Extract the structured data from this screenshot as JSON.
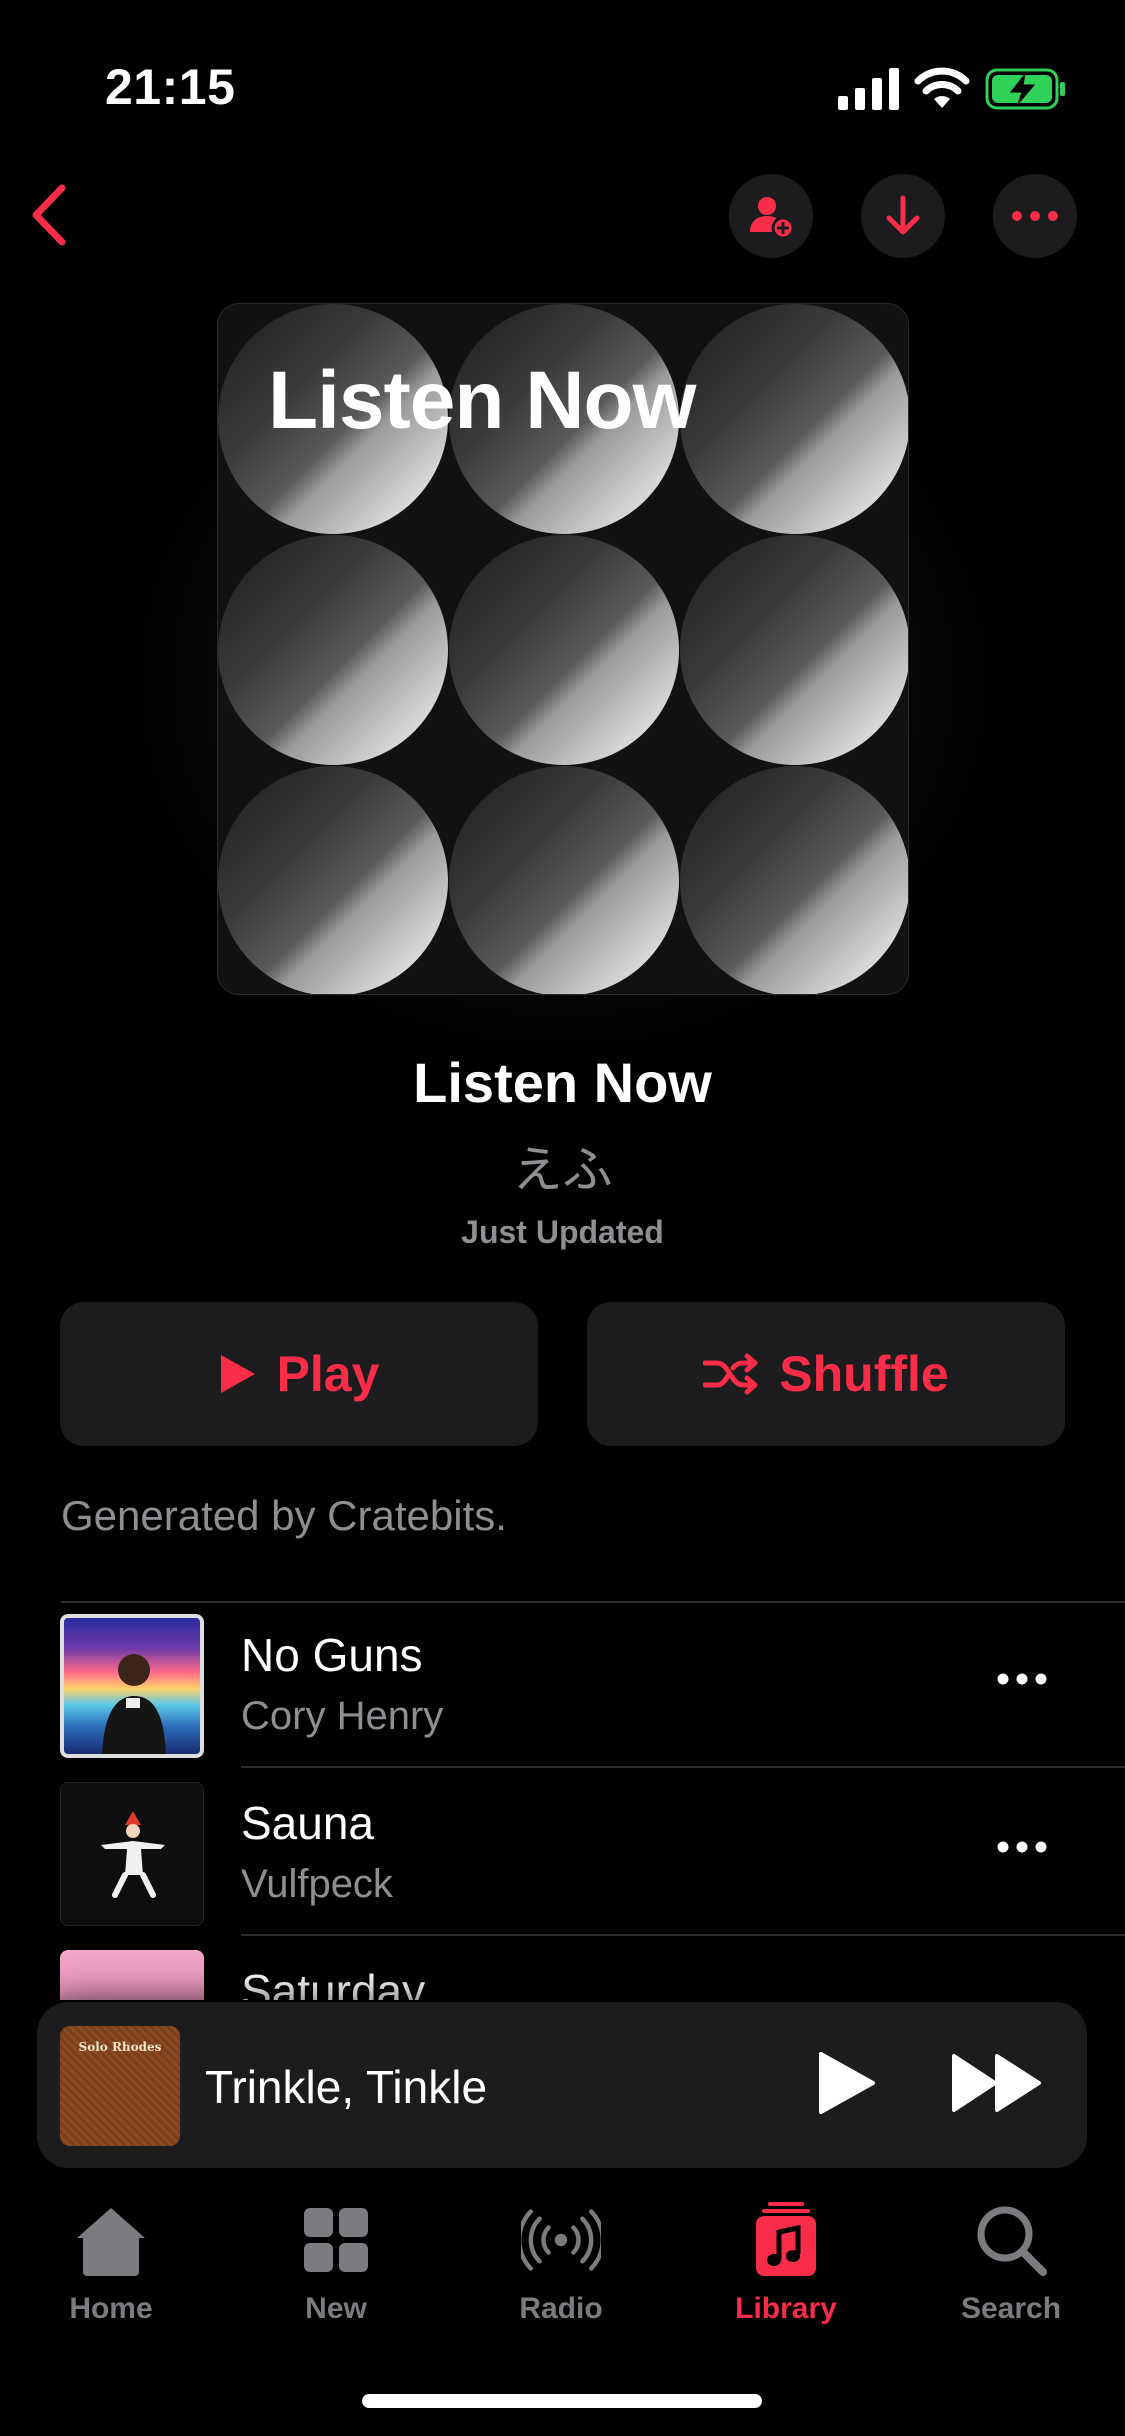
{
  "status_bar": {
    "time": "21:15"
  },
  "playlist": {
    "artwork_title": "Listen Now",
    "title": "Listen Now",
    "owner": "えふ",
    "updated": "Just Updated",
    "description": "Generated by Cratebits."
  },
  "actions": {
    "play_label": "Play",
    "shuffle_label": "Shuffle"
  },
  "tracks": [
    {
      "title": "No Guns",
      "artist": "Cory Henry"
    },
    {
      "title": "Sauna",
      "artist": "Vulfpeck"
    },
    {
      "title": "Saturday",
      "artist": ""
    }
  ],
  "mini_player": {
    "title": "Trinkle, Tinkle",
    "artwork_text": "Solo Rhodes"
  },
  "tab_bar": [
    {
      "label": "Home",
      "icon": "home-icon"
    },
    {
      "label": "New",
      "icon": "grid-icon"
    },
    {
      "label": "Radio",
      "icon": "radio-icon"
    },
    {
      "label": "Library",
      "icon": "library-icon",
      "active": true
    },
    {
      "label": "Search",
      "icon": "search-icon"
    }
  ],
  "colors": {
    "accent": "#fa2d48",
    "background": "#000000",
    "surface": "#1c1c1e",
    "secondary_text": "#8e8e93"
  }
}
